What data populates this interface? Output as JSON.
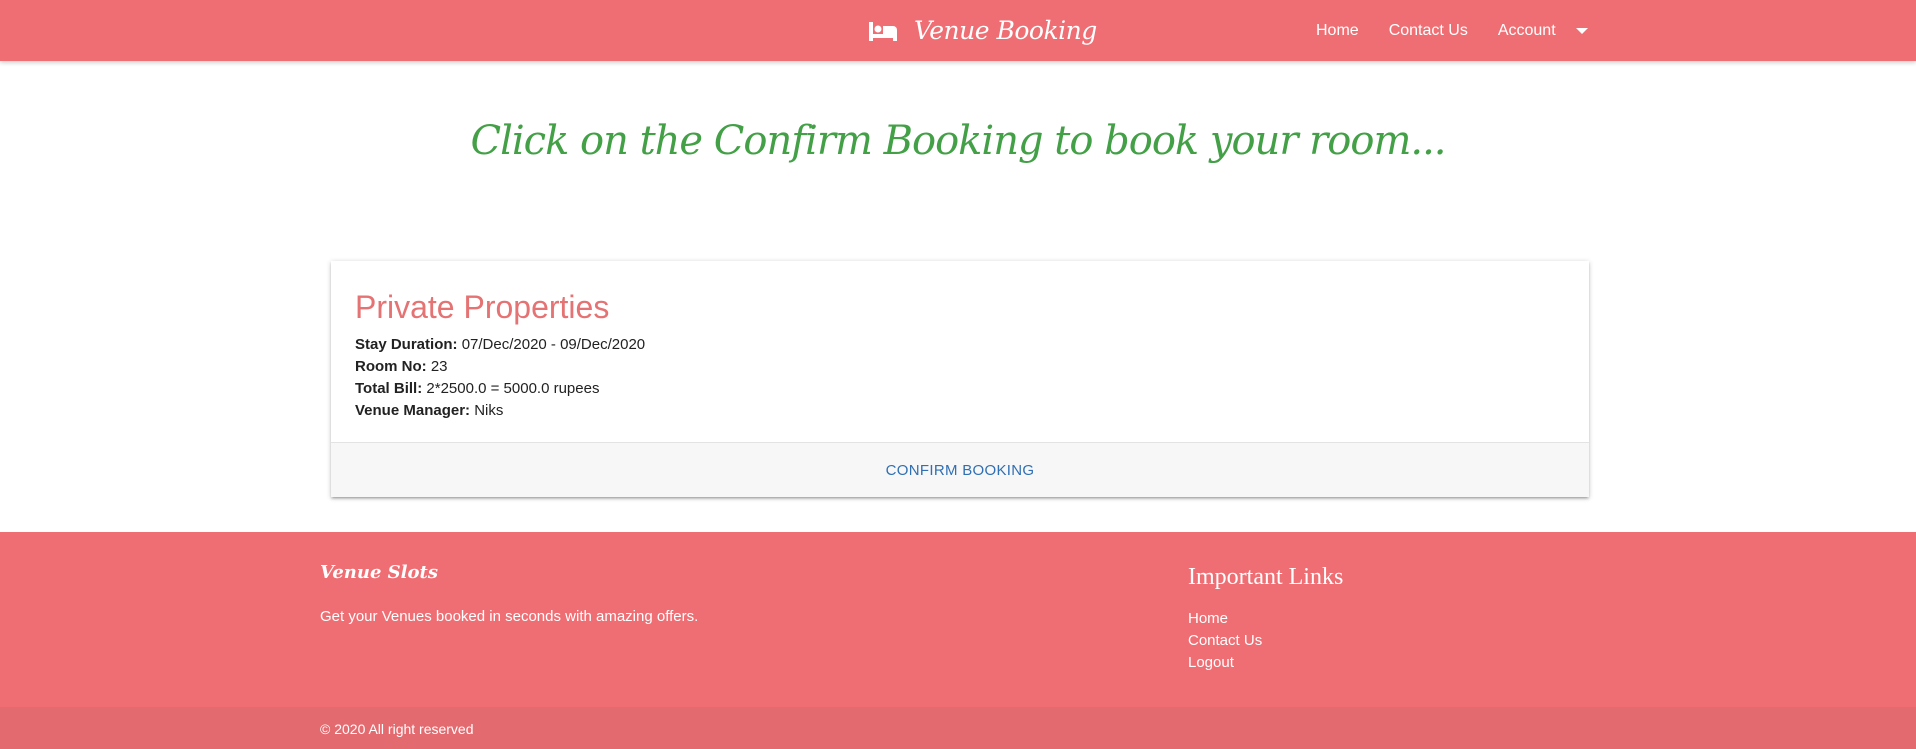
{
  "navbar": {
    "brand": "Venue Booking",
    "brand_icon": "bed-icon",
    "links": [
      "Home",
      "Contact Us",
      "Account"
    ]
  },
  "headline": "Click on the Confirm Booking to book your room...",
  "booking": {
    "title": "Private Properties",
    "stay_duration_label": "Stay Duration:",
    "stay_duration": "07/Dec/2020 - 09/Dec/2020",
    "room_no_label": "Room No:",
    "room_no": "23",
    "total_bill_label": "Total Bill:",
    "total_bill": "2*2500.0 = 5000.0 rupees",
    "manager_label": "Venue Manager:",
    "manager": "Niks",
    "confirm_label": "CONFIRM BOOKING"
  },
  "footer": {
    "brand": "Venue Slots",
    "tagline": "Get your Venues booked in seconds with amazing offers.",
    "links_title": "Important Links",
    "links": [
      "Home",
      "Contact Us",
      "Logout"
    ],
    "copyright": "© 2020 All right reserved"
  },
  "colors": {
    "primary": "#ef6e73",
    "headline": "#43a047",
    "card_title": "#e57373",
    "action": "#2f6fb3"
  }
}
